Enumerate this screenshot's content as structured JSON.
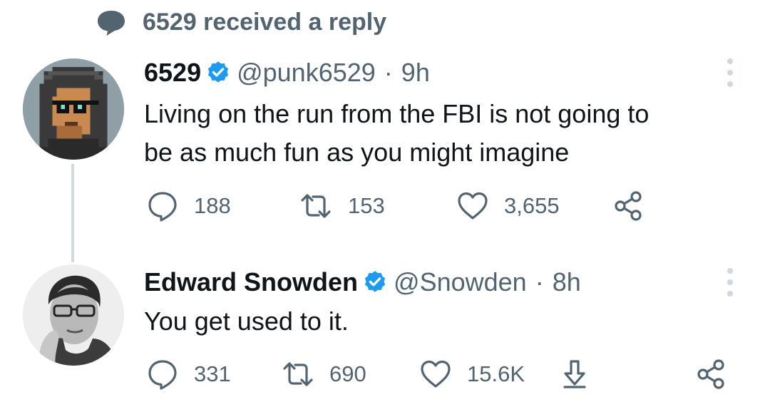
{
  "context": {
    "icon": "speech-bubble-icon",
    "text": "6529 received a reply"
  },
  "tweets": [
    {
      "avatar": "pixel-punk-avatar",
      "name": "6529",
      "verified": true,
      "handle": "@punk6529",
      "separator": "·",
      "time": "9h",
      "text_lines": [
        "Living on the run from the FBI is not going to",
        "be as much fun as you might imagine"
      ],
      "actions": {
        "reply_count": "188",
        "retweet_count": "153",
        "like_count": "3,655"
      }
    },
    {
      "avatar": "photo-avatar",
      "name": "Edward Snowden",
      "verified": true,
      "handle": "@Snowden",
      "separator": "·",
      "time": "8h",
      "text_lines": [
        "You get used to it."
      ],
      "actions": {
        "reply_count": "331",
        "retweet_count": "690",
        "like_count": "15.6K"
      }
    }
  ],
  "colors": {
    "muted": "#536471",
    "verified": "#1d9bf0",
    "thread_line": "#cfd9de"
  }
}
